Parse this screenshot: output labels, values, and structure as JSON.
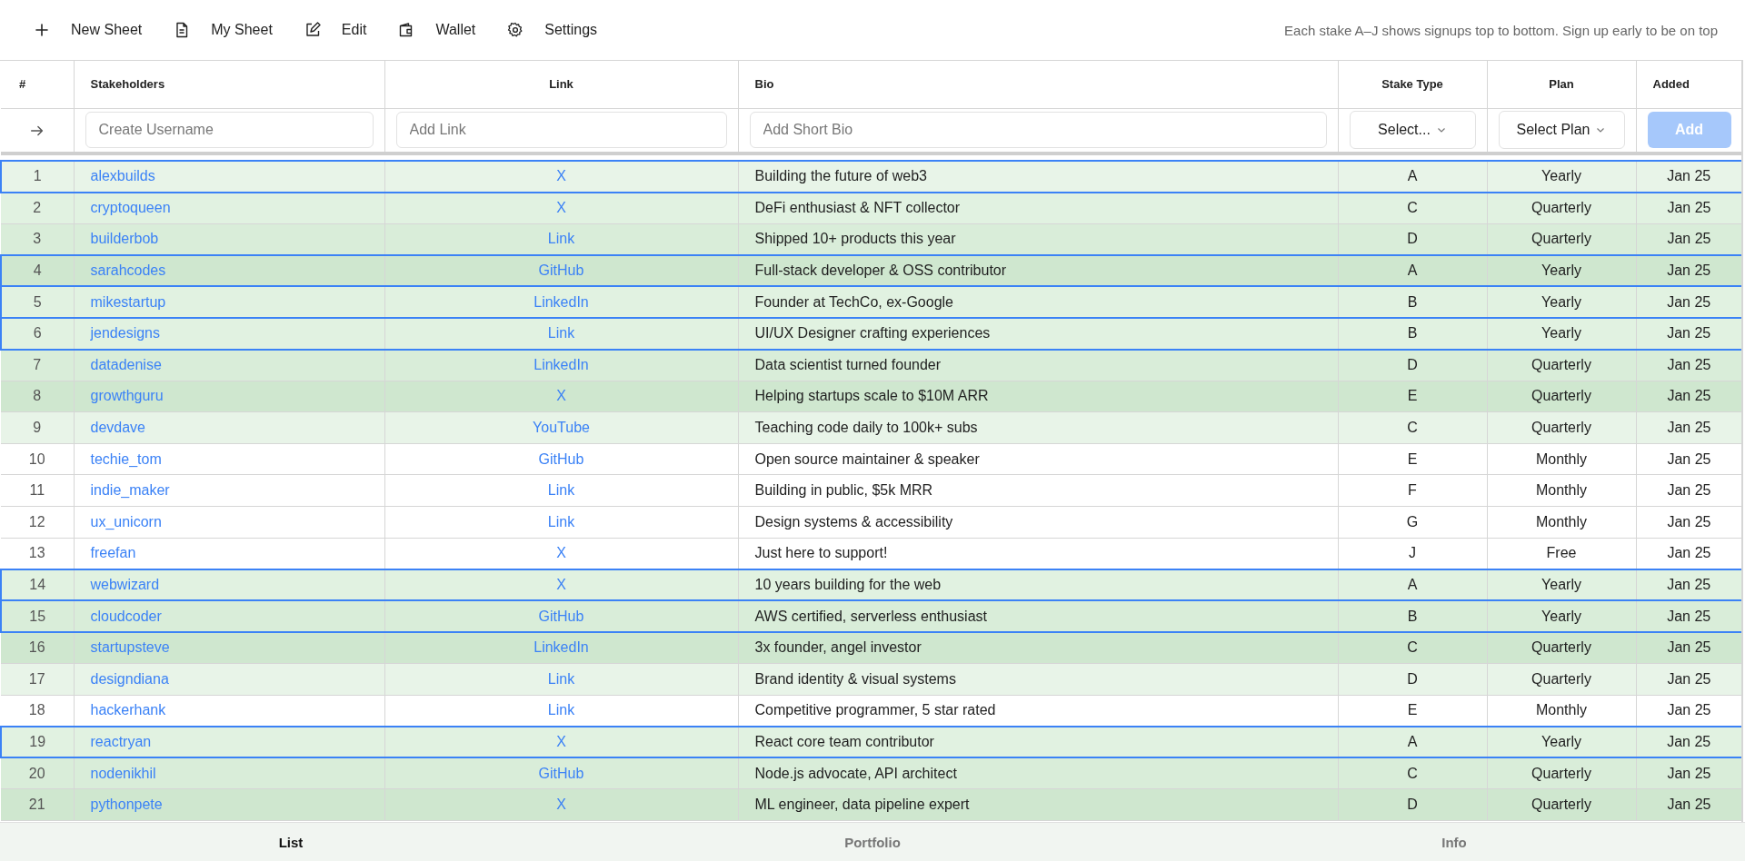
{
  "toolbar": [
    {
      "kind": "plus",
      "label": "New Sheet"
    },
    {
      "kind": "document",
      "label": "My Sheet"
    },
    {
      "kind": "edit",
      "label": "Edit"
    },
    {
      "kind": "wallet",
      "label": "Wallet"
    },
    {
      "kind": "gear",
      "label": "Settings"
    }
  ],
  "hint": "Each stake A–J shows signups top to bottom. Sign up early to be on top",
  "table": {
    "columns": [
      "#",
      "Stakeholders",
      "Link",
      "Bio",
      "Stake Type",
      "Plan",
      "Added"
    ],
    "entry_row": {
      "username": {
        "placeholder": "Create Username"
      },
      "link": {
        "placeholder": "Add Link"
      },
      "bio": {
        "placeholder": "Add Short Bio"
      },
      "stake_type": {
        "value": "Select..."
      },
      "plan": {
        "value": "Select Plan"
      },
      "add_button": {
        "label": "Add",
        "disabled": true
      }
    },
    "rows": [
      {
        "number": "1",
        "username": "alexbuilds",
        "link": "X",
        "bio": "Building the future of web3",
        "stake": "A",
        "plan": "Yearly",
        "added": "Jan 25",
        "color": "#e8f4e8",
        "selected": true
      },
      {
        "number": "2",
        "username": "cryptoqueen",
        "link": "X",
        "bio": "DeFi enthusiast & NFT collector",
        "stake": "C",
        "plan": "Quarterly",
        "added": "Jan 25",
        "color": "#e1f2e1",
        "selected": false
      },
      {
        "number": "3",
        "username": "builderbob",
        "link": "Link",
        "bio": "Shipped 10+ products this year",
        "stake": "D",
        "plan": "Quarterly",
        "added": "Jan 25",
        "color": "#d9edd9",
        "selected": false
      },
      {
        "number": "4",
        "username": "sarahcodes",
        "link": "GitHub",
        "bio": "Full-stack developer & OSS contributor",
        "stake": "A",
        "plan": "Yearly",
        "added": "Jan 25",
        "color": "#cfe7cf",
        "selected": true
      },
      {
        "number": "5",
        "username": "mikestartup",
        "link": "LinkedIn",
        "bio": "Founder at TechCo, ex-Google",
        "stake": "B",
        "plan": "Yearly",
        "added": "Jan 25",
        "color": "#e1f2e1",
        "selected": true
      },
      {
        "number": "6",
        "username": "jendesigns",
        "link": "Link",
        "bio": "UI/UX Designer crafting experiences",
        "stake": "B",
        "plan": "Yearly",
        "added": "Jan 25",
        "color": "#e1f2e1",
        "selected": true
      },
      {
        "number": "7",
        "username": "datadenise",
        "link": "LinkedIn",
        "bio": "Data scientist turned founder",
        "stake": "D",
        "plan": "Quarterly",
        "added": "Jan 25",
        "color": "#d9edd9",
        "selected": false
      },
      {
        "number": "8",
        "username": "growthguru",
        "link": "X",
        "bio": "Helping startups scale to $10M ARR",
        "stake": "E",
        "plan": "Quarterly",
        "added": "Jan 25",
        "color": "#cfe7cf",
        "selected": false
      },
      {
        "number": "9",
        "username": "devdave",
        "link": "YouTube",
        "bio": "Teaching code daily to 100k+ subs",
        "stake": "C",
        "plan": "Quarterly",
        "added": "Jan 25",
        "color": "#e8f4e8",
        "selected": false
      },
      {
        "number": "10",
        "username": "techie_tom",
        "link": "GitHub",
        "bio": "Open source maintainer & speaker",
        "stake": "E",
        "plan": "Monthly",
        "added": "Jan 25",
        "color": "#ffffff",
        "selected": false
      },
      {
        "number": "11",
        "username": "indie_maker",
        "link": "Link",
        "bio": "Building in public, $5k MRR",
        "stake": "F",
        "plan": "Monthly",
        "added": "Jan 25",
        "color": "#ffffff",
        "selected": false
      },
      {
        "number": "12",
        "username": "ux_unicorn",
        "link": "Link",
        "bio": "Design systems & accessibility",
        "stake": "G",
        "plan": "Monthly",
        "added": "Jan 25",
        "color": "#ffffff",
        "selected": false
      },
      {
        "number": "13",
        "username": "freefan",
        "link": "X",
        "bio": "Just here to support!",
        "stake": "J",
        "plan": "Free",
        "added": "Jan 25",
        "color": "#ffffff",
        "selected": false
      },
      {
        "number": "14",
        "username": "webwizard",
        "link": "X",
        "bio": "10 years building for the web",
        "stake": "A",
        "plan": "Yearly",
        "added": "Jan 25",
        "color": "#e1f2e1",
        "selected": true
      },
      {
        "number": "15",
        "username": "cloudcoder",
        "link": "GitHub",
        "bio": "AWS certified, serverless enthusiast",
        "stake": "B",
        "plan": "Yearly",
        "added": "Jan 25",
        "color": "#d9edd9",
        "selected": true
      },
      {
        "number": "16",
        "username": "startupsteve",
        "link": "LinkedIn",
        "bio": "3x founder, angel investor",
        "stake": "C",
        "plan": "Quarterly",
        "added": "Jan 25",
        "color": "#cfe7cf",
        "selected": false
      },
      {
        "number": "17",
        "username": "designdiana",
        "link": "Link",
        "bio": "Brand identity & visual systems",
        "stake": "D",
        "plan": "Quarterly",
        "added": "Jan 25",
        "color": "#e8f4e8",
        "selected": false
      },
      {
        "number": "18",
        "username": "hackerhank",
        "link": "Link",
        "bio": "Competitive programmer, 5 star rated",
        "stake": "E",
        "plan": "Monthly",
        "added": "Jan 25",
        "color": "#ffffff",
        "selected": false
      },
      {
        "number": "19",
        "username": "reactryan",
        "link": "X",
        "bio": "React core team contributor",
        "stake": "A",
        "plan": "Yearly",
        "added": "Jan 25",
        "color": "#e1f2e1",
        "selected": true
      },
      {
        "number": "20",
        "username": "nodenikhil",
        "link": "GitHub",
        "bio": "Node.js advocate, API architect",
        "stake": "C",
        "plan": "Quarterly",
        "added": "Jan 25",
        "color": "#d9edd9",
        "selected": false
      },
      {
        "number": "21",
        "username": "pythonpete",
        "link": "X",
        "bio": "ML engineer, data pipeline expert",
        "stake": "D",
        "plan": "Quarterly",
        "added": "Jan 25",
        "color": "#cfe7cf",
        "selected": false
      }
    ]
  },
  "bottom_tabs": [
    {
      "label": "List",
      "selected": true
    },
    {
      "label": "Portfolio",
      "selected": false
    },
    {
      "label": "Info",
      "selected": false
    }
  ]
}
